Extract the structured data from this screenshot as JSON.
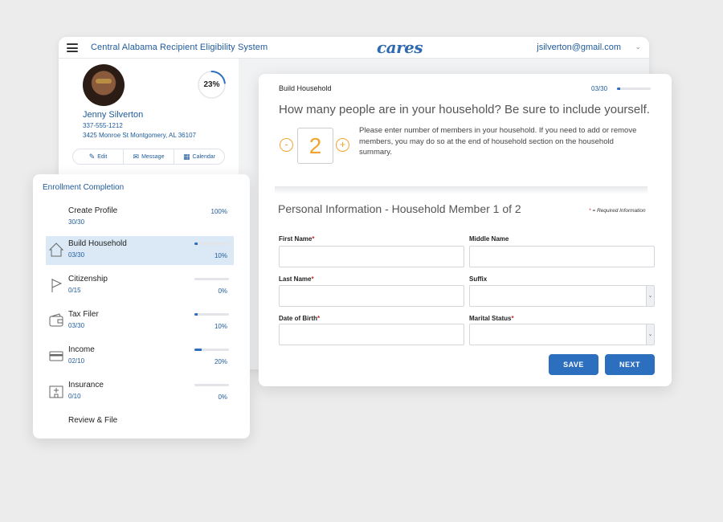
{
  "header": {
    "app_title": "Central Alabama Recipient Eligibility System",
    "logo": "cares",
    "user_email": "jsilverton@gmail.com"
  },
  "profile": {
    "name": "Jenny Silverton",
    "phone": "337-555-1212",
    "address": "3425 Monroe St  Montgomery, AL 36107",
    "progress": "23%",
    "progress_value": 0.23,
    "actions": [
      {
        "label": "Edit",
        "icon": "pencil-icon"
      },
      {
        "label": "Message",
        "icon": "envelope-icon"
      },
      {
        "label": "Calendar",
        "icon": "calendar-icon"
      }
    ]
  },
  "enrollment": {
    "title": "Enrollment Completion",
    "steps": [
      {
        "label": "Create Profile",
        "count": "30/30",
        "pct": "100%",
        "fraction": 1.0,
        "icon": "none"
      },
      {
        "label": "Build Household",
        "count": "03/30",
        "pct": "10%",
        "fraction": 0.1,
        "icon": "house-icon"
      },
      {
        "label": "Citizenship",
        "count": "0/15",
        "pct": "0%",
        "fraction": 0.0,
        "icon": "flag-icon"
      },
      {
        "label": "Tax Filer",
        "count": "03/30",
        "pct": "10%",
        "fraction": 0.1,
        "icon": "wallet-icon"
      },
      {
        "label": "Income",
        "count": "02/10",
        "pct": "20%",
        "fraction": 0.2,
        "icon": "credit-card-icon"
      },
      {
        "label": "Insurance",
        "count": "0/10",
        "pct": "0%",
        "fraction": 0.0,
        "icon": "hospital-icon"
      },
      {
        "label": "Review & File",
        "count": "",
        "pct": "",
        "icon": "none"
      }
    ]
  },
  "household": {
    "step_title": "Build Household",
    "step_count": "03/30",
    "step_fraction": 0.1,
    "question": "How many people are in your household? Be sure to include yourself.",
    "count": "2",
    "minus": "-",
    "plus": "+",
    "help_text": "Please enter number of members in your household. If you need to add or remove members, you may do so at the end of household section on the household summary."
  },
  "personal": {
    "title": "Personal Information - Household Member 1 of 2",
    "required_note": "= Required Information",
    "star": "*",
    "fields": {
      "first_name": "First Name",
      "middle_name": "Middle Name",
      "last_name": "Last Name",
      "suffix": "Suffix",
      "dob": "Date of Birth",
      "marital": "Marital Status"
    },
    "save": "SAVE",
    "next": "NEXT"
  },
  "colors": {
    "accent": "#2d6fbf",
    "link": "#1e5a9a",
    "highlight": "#f0a532",
    "required": "#c62828"
  }
}
